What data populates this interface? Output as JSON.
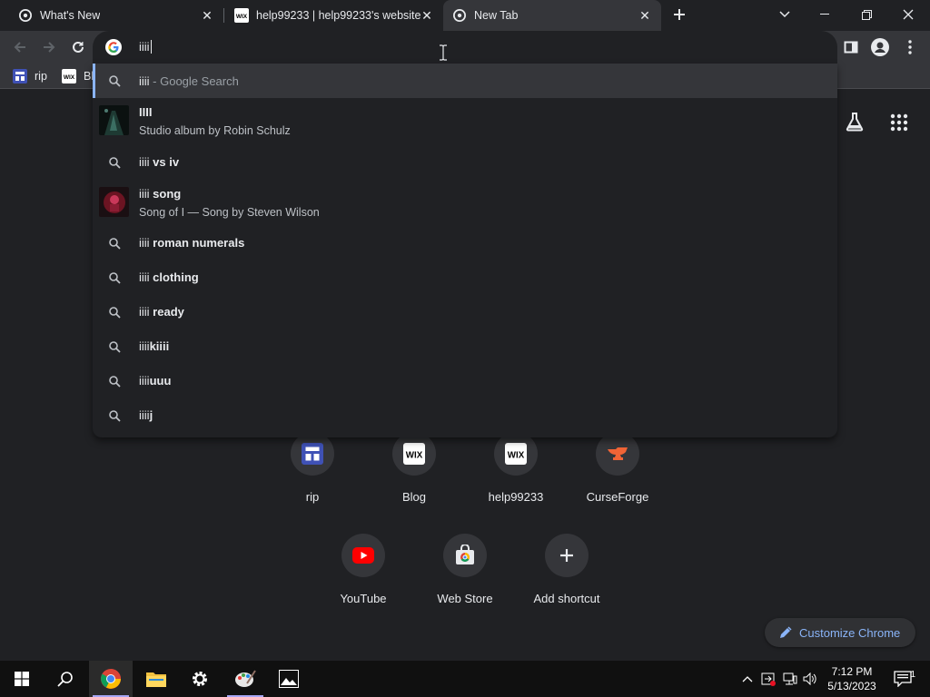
{
  "tabs": [
    {
      "title": "What's New",
      "icon": "chrome-icon"
    },
    {
      "title": "help99233 | help99233's website",
      "icon": "wix-icon"
    },
    {
      "title": "New Tab",
      "icon": "chrome-icon"
    }
  ],
  "omnibox": {
    "typed": "iiii"
  },
  "bookmarks": [
    {
      "label": "rip",
      "icon": "rip-app-icon"
    },
    {
      "label": "Bl",
      "icon": "wix-icon"
    }
  ],
  "suggestions": [
    {
      "type": "search",
      "prefix": "iiii",
      "bold": "",
      "muted": " - Google Search",
      "selected": true
    },
    {
      "type": "entity",
      "prefix": "",
      "bold": "IIII",
      "sub": "Studio album by Robin Schulz"
    },
    {
      "type": "search",
      "prefix": "iiii",
      "bold": " vs iv"
    },
    {
      "type": "entity",
      "prefix": "iiii",
      "bold": " song",
      "sub": "Song of I — Song by Steven Wilson"
    },
    {
      "type": "search",
      "prefix": "iiii",
      "bold": " roman numerals"
    },
    {
      "type": "search",
      "prefix": "iiii",
      "bold": " clothing"
    },
    {
      "type": "search",
      "prefix": "iiii",
      "bold": " ready"
    },
    {
      "type": "search",
      "prefix": "iiii",
      "bold": "kiiii"
    },
    {
      "type": "search",
      "prefix": "iiii",
      "bold": "uuu"
    },
    {
      "type": "search",
      "prefix": "iiii",
      "bold": "j"
    }
  ],
  "shortcuts": [
    {
      "label": "rip",
      "icon": "rip-app-icon"
    },
    {
      "label": "Blog",
      "icon": "wix-icon"
    },
    {
      "label": "help99233",
      "icon": "wix-icon"
    },
    {
      "label": "CurseForge",
      "icon": "curseforge-icon"
    },
    {
      "label": "YouTube",
      "icon": "youtube-icon"
    },
    {
      "label": "Web Store",
      "icon": "web-store-icon"
    },
    {
      "label": "Add shortcut",
      "icon": "plus-icon"
    }
  ],
  "customize_label": "Customize Chrome",
  "clock": {
    "time": "7:12 PM",
    "date": "5/13/2023"
  },
  "notification_count": "1",
  "colors": {
    "accent": "#8ab4f8",
    "background": "#202124",
    "toolbar": "#35363a",
    "taskbar": "#101010"
  }
}
